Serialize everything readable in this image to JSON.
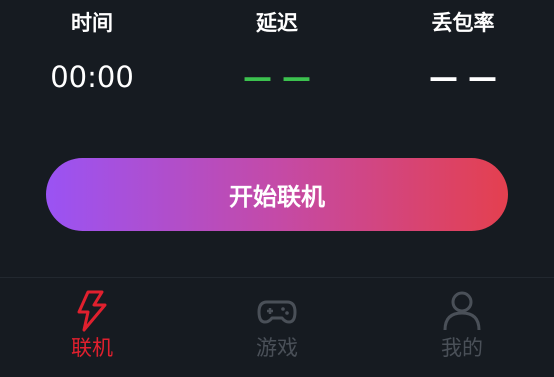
{
  "stats": {
    "time": {
      "label": "时间",
      "value": "00:00"
    },
    "latency": {
      "label": "延迟",
      "value": "— —"
    },
    "packet_loss": {
      "label": "丢包率",
      "value": "— —"
    }
  },
  "main": {
    "start_button_label": "开始联机"
  },
  "tabbar": {
    "tabs": [
      {
        "label": "联机",
        "icon": "lightning-icon",
        "active": true
      },
      {
        "label": "游戏",
        "icon": "gamepad-icon",
        "active": false
      },
      {
        "label": "我的",
        "icon": "user-icon",
        "active": false
      }
    ]
  },
  "colors": {
    "background": "#161b21",
    "accent_red": "#e0202e",
    "latency_green": "#3cc24f",
    "inactive_gray": "#4a5058",
    "button_gradient_start": "#9a53f4",
    "button_gradient_end": "#e4404f"
  }
}
